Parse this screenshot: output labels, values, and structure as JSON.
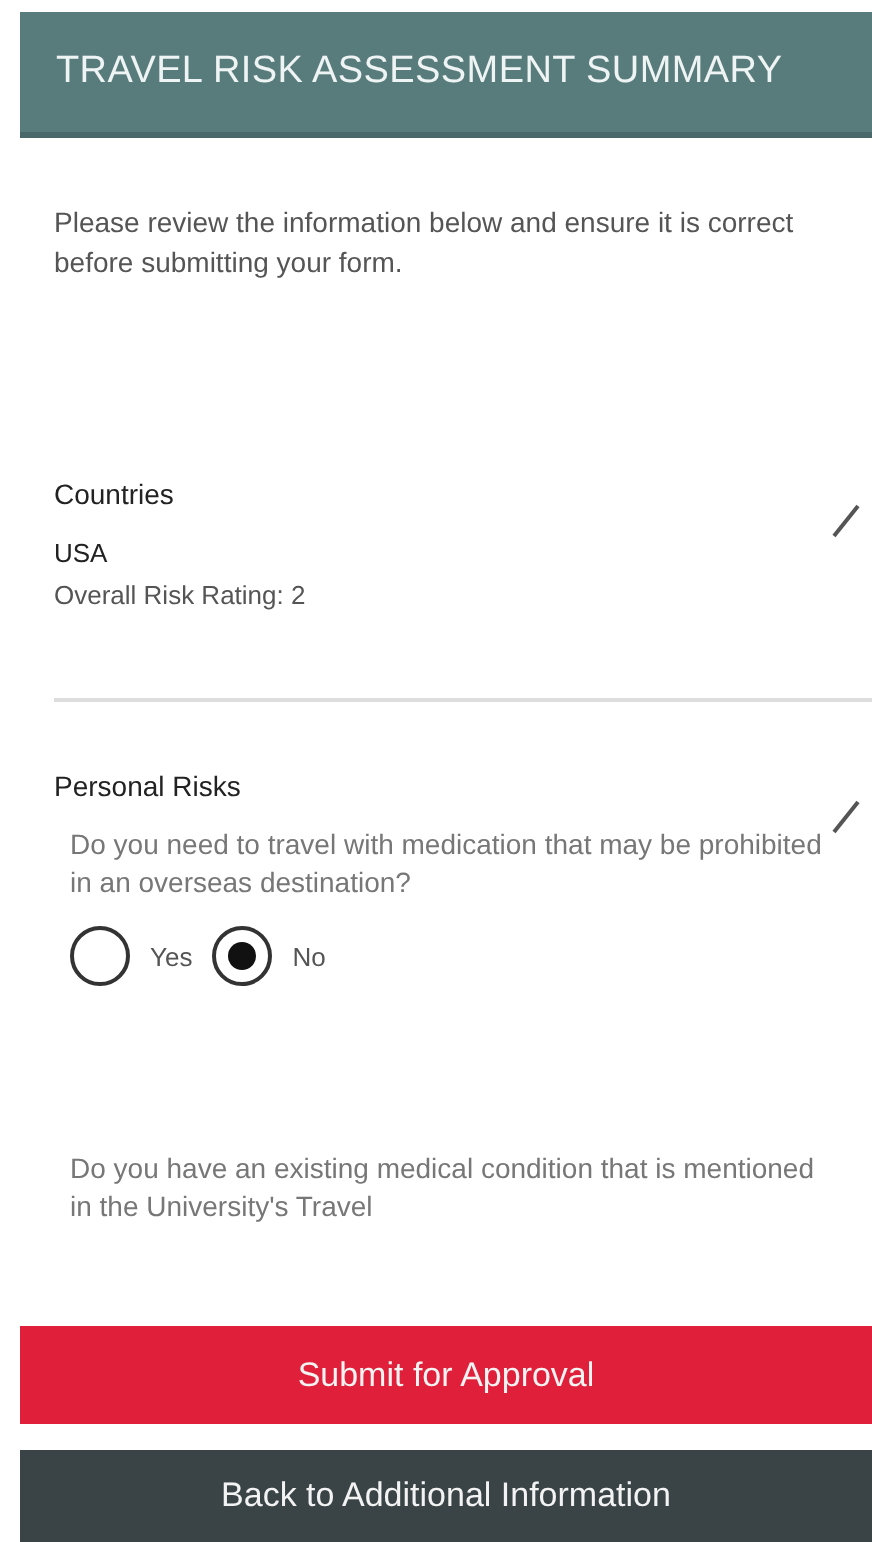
{
  "header": {
    "title": "TRAVEL RISK ASSESSMENT SUMMARY"
  },
  "intro": "Please review the information below and ensure it is correct before submitting your form.",
  "sections": [
    {
      "title": "Countries",
      "items": [
        {
          "kind": "value",
          "text": "USA"
        },
        {
          "kind": "note",
          "text": "Overall Risk Rating: 2"
        }
      ]
    },
    {
      "title": "Personal Risks",
      "items": [
        {
          "kind": "question",
          "text": "Do you need to travel with medication that may be prohibited in an overseas destination?",
          "options": [
            {
              "label": "Yes",
              "selected": false
            },
            {
              "label": "No",
              "selected": true
            }
          ]
        },
        {
          "kind": "question",
          "text": "Do you have an existing medical condition that is mentioned in the University's Travel"
        }
      ]
    }
  ],
  "buttons": [
    {
      "kind": "primary",
      "label": "Submit for Approval"
    },
    {
      "kind": "secondary",
      "label": "Back to Additional Information"
    }
  ]
}
